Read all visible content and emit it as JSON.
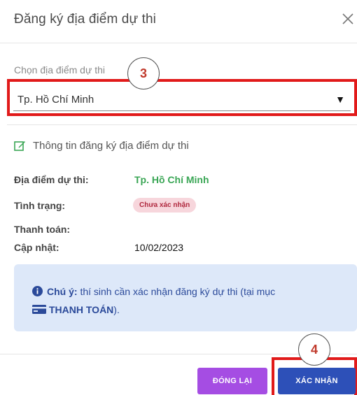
{
  "dialog": {
    "title": "Đăng ký địa điểm dự thi"
  },
  "location_select": {
    "label": "Chọn địa điểm dự thi",
    "value": "Tp. Hồ Chí Minh",
    "arrow": "▼"
  },
  "annotations": {
    "step3": "3",
    "step4": "4"
  },
  "info_section": {
    "heading": "Thông tin đăng ký địa điểm dự thi",
    "location_label": "Địa điểm dự thi:",
    "location_value": "Tp. Hồ Chí Minh",
    "status_label": "Tình trạng:",
    "status_value": "Chưa xác nhận",
    "payment_label": "Thanh toán:",
    "payment_value": "",
    "updated_label": "Cập nhật:",
    "updated_value": "10/02/2023"
  },
  "note": {
    "prefix": "Chú ý:",
    "text": " thí sinh cần xác nhận đăng ký dự thi (tại mục ",
    "link": "THANH TOÁN",
    "suffix": ")."
  },
  "buttons": {
    "close": "ĐÓNG LẠI",
    "confirm": "XÁC NHẬN"
  },
  "colors": {
    "accent_green": "#3aa655",
    "highlight_red": "#e11a1a",
    "close_button": "#a54de3",
    "confirm_button": "#2d50b8",
    "note_bg": "#dde8f9"
  },
  "icons": [
    "close-icon",
    "edit-icon",
    "info-icon",
    "card-icon"
  ]
}
